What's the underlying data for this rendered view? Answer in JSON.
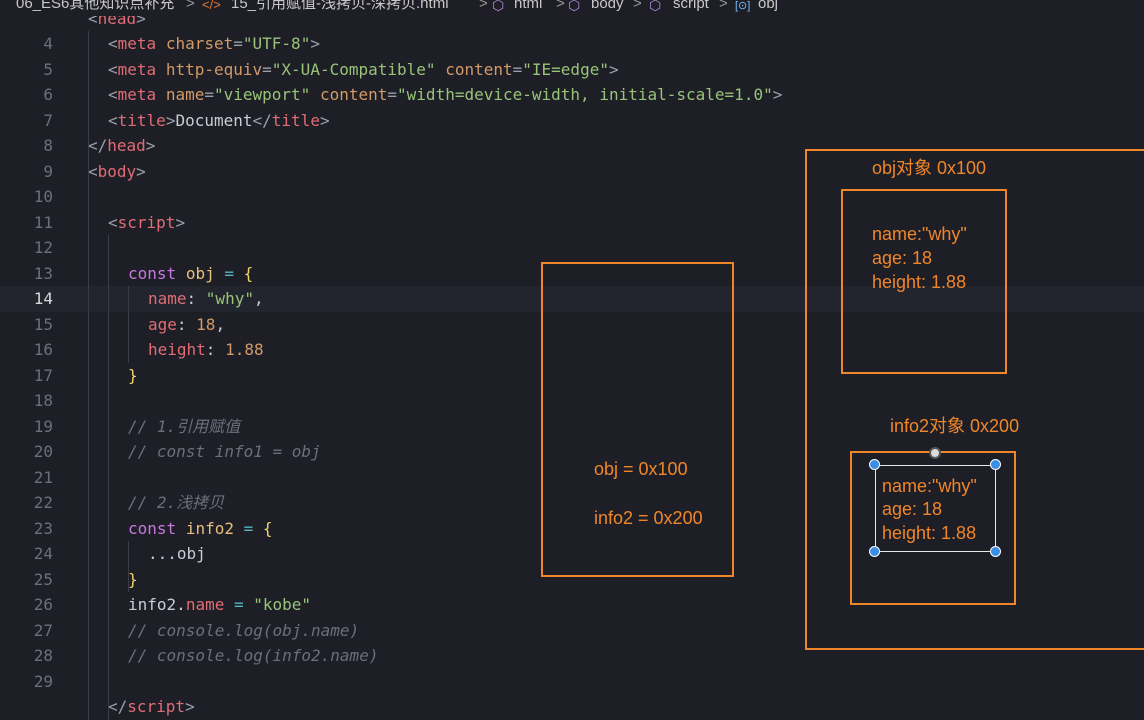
{
  "breadcrumb": {
    "items": [
      {
        "label": "06_ES6其他知识点补充",
        "icon": ""
      },
      {
        "label": "15_引用赋值-浅拷贝-深拷贝.html",
        "icon": "</>"
      },
      {
        "label": "html",
        "icon": "cube-icon"
      },
      {
        "label": "body",
        "icon": "cube-icon"
      },
      {
        "label": "script",
        "icon": "cube-icon"
      },
      {
        "label": "obj",
        "icon": "variable-icon"
      }
    ],
    "separator": ">"
  },
  "editor": {
    "current_line": 14,
    "lines": [
      {
        "n": "4",
        "tokens": [
          [
            "punct",
            "<"
          ],
          [
            "tag",
            "meta"
          ],
          [
            "plain",
            " "
          ],
          [
            "attr",
            "charset"
          ],
          [
            "punct",
            "="
          ],
          [
            "str",
            "\"UTF-8\""
          ],
          [
            "punct",
            ">"
          ]
        ],
        "indent": 1
      },
      {
        "n": "5",
        "tokens": [
          [
            "punct",
            "<"
          ],
          [
            "tag",
            "meta"
          ],
          [
            "plain",
            " "
          ],
          [
            "attr",
            "http-equiv"
          ],
          [
            "punct",
            "="
          ],
          [
            "str",
            "\"X-UA-Compatible\""
          ],
          [
            "plain",
            " "
          ],
          [
            "attr",
            "content"
          ],
          [
            "punct",
            "="
          ],
          [
            "str",
            "\"IE=edge\""
          ],
          [
            "punct",
            ">"
          ]
        ],
        "indent": 1
      },
      {
        "n": "6",
        "tokens": [
          [
            "punct",
            "<"
          ],
          [
            "tag",
            "meta"
          ],
          [
            "plain",
            " "
          ],
          [
            "attr",
            "name"
          ],
          [
            "punct",
            "="
          ],
          [
            "str",
            "\"viewport\""
          ],
          [
            "plain",
            " "
          ],
          [
            "attr",
            "content"
          ],
          [
            "punct",
            "="
          ],
          [
            "str",
            "\"width=device-width, initial-scale=1.0\""
          ],
          [
            "punct",
            ">"
          ]
        ],
        "indent": 1
      },
      {
        "n": "7",
        "tokens": [
          [
            "punct",
            "<"
          ],
          [
            "tag",
            "title"
          ],
          [
            "punct",
            ">"
          ],
          [
            "plain",
            "Document"
          ],
          [
            "punct",
            "</"
          ],
          [
            "tag",
            "title"
          ],
          [
            "punct",
            ">"
          ]
        ],
        "indent": 1
      },
      {
        "n": "8",
        "tokens": [
          [
            "punct",
            "</"
          ],
          [
            "tag",
            "head"
          ],
          [
            "punct",
            ">"
          ]
        ],
        "indent": 0
      },
      {
        "n": "9",
        "tokens": [
          [
            "punct",
            "<"
          ],
          [
            "tag",
            "body"
          ],
          [
            "punct",
            ">"
          ]
        ],
        "indent": 0
      },
      {
        "n": "10",
        "tokens": [],
        "indent": 0
      },
      {
        "n": "11",
        "tokens": [
          [
            "punct",
            "<"
          ],
          [
            "tag",
            "script"
          ],
          [
            "punct",
            ">"
          ]
        ],
        "indent": 1
      },
      {
        "n": "12",
        "tokens": [],
        "indent": 0
      },
      {
        "n": "13",
        "tokens": [
          [
            "kw",
            "const"
          ],
          [
            "plain",
            " "
          ],
          [
            "var",
            "obj"
          ],
          [
            "plain",
            " "
          ],
          [
            "op",
            "="
          ],
          [
            "plain",
            " "
          ],
          [
            "brace",
            "{"
          ]
        ],
        "indent": 2
      },
      {
        "n": "14",
        "tokens": [
          [
            "prop",
            "name"
          ],
          [
            "plain",
            ": "
          ],
          [
            "str",
            "\"why\""
          ],
          [
            "plain",
            ","
          ]
        ],
        "indent": 3
      },
      {
        "n": "15",
        "tokens": [
          [
            "prop",
            "age"
          ],
          [
            "plain",
            ": "
          ],
          [
            "num",
            "18"
          ],
          [
            "plain",
            ","
          ]
        ],
        "indent": 3
      },
      {
        "n": "16",
        "tokens": [
          [
            "prop",
            "height"
          ],
          [
            "plain",
            ": "
          ],
          [
            "num",
            "1.88"
          ]
        ],
        "indent": 3
      },
      {
        "n": "17",
        "tokens": [
          [
            "brace",
            "}"
          ]
        ],
        "indent": 2
      },
      {
        "n": "18",
        "tokens": [],
        "indent": 0
      },
      {
        "n": "19",
        "tokens": [
          [
            "comment",
            "// 1.引用赋值"
          ]
        ],
        "indent": 2
      },
      {
        "n": "20",
        "tokens": [
          [
            "comment",
            "// const info1 = obj"
          ]
        ],
        "indent": 2
      },
      {
        "n": "21",
        "tokens": [],
        "indent": 0
      },
      {
        "n": "22",
        "tokens": [
          [
            "comment",
            "// 2.浅拷贝"
          ]
        ],
        "indent": 2
      },
      {
        "n": "23",
        "tokens": [
          [
            "kw",
            "const"
          ],
          [
            "plain",
            " "
          ],
          [
            "var",
            "info2"
          ],
          [
            "plain",
            " "
          ],
          [
            "op",
            "="
          ],
          [
            "plain",
            " "
          ],
          [
            "brace",
            "{"
          ]
        ],
        "indent": 2
      },
      {
        "n": "24",
        "tokens": [
          [
            "plain",
            "..."
          ],
          [
            "plain",
            "obj"
          ]
        ],
        "indent": 3
      },
      {
        "n": "25",
        "tokens": [
          [
            "brace",
            "}"
          ]
        ],
        "indent": 2
      },
      {
        "n": "26",
        "tokens": [
          [
            "plain",
            "info2"
          ],
          [
            "plain",
            "."
          ],
          [
            "prop",
            "name"
          ],
          [
            "plain",
            " "
          ],
          [
            "op",
            "="
          ],
          [
            "plain",
            " "
          ],
          [
            "str",
            "\"kobe\""
          ]
        ],
        "indent": 2
      },
      {
        "n": "27",
        "tokens": [
          [
            "comment",
            "// console.log(obj.name)"
          ]
        ],
        "indent": 2
      },
      {
        "n": "28",
        "tokens": [
          [
            "comment",
            "// console.log(info2.name)"
          ]
        ],
        "indent": 2
      },
      {
        "n": "29",
        "tokens": [],
        "indent": 0
      },
      {
        "n": "",
        "tokens": [
          [
            "punct",
            "</"
          ],
          [
            "tag",
            "script"
          ],
          [
            "punct",
            ">"
          ]
        ],
        "indent": 1
      }
    ]
  },
  "annotations": {
    "stack_box": {
      "line1": "obj = 0x100",
      "line2": "info2 = 0x200"
    },
    "heap_obj": {
      "title": "obj对象 0x100",
      "line1": "name:\"why\"",
      "line2": "age: 18",
      "line3": "height: 1.88"
    },
    "heap_info2": {
      "title": "info2对象 0x200",
      "line1": "name:\"why\"",
      "line2": "age: 18",
      "line3": "height: 1.88"
    },
    "color": "#f0862a"
  }
}
